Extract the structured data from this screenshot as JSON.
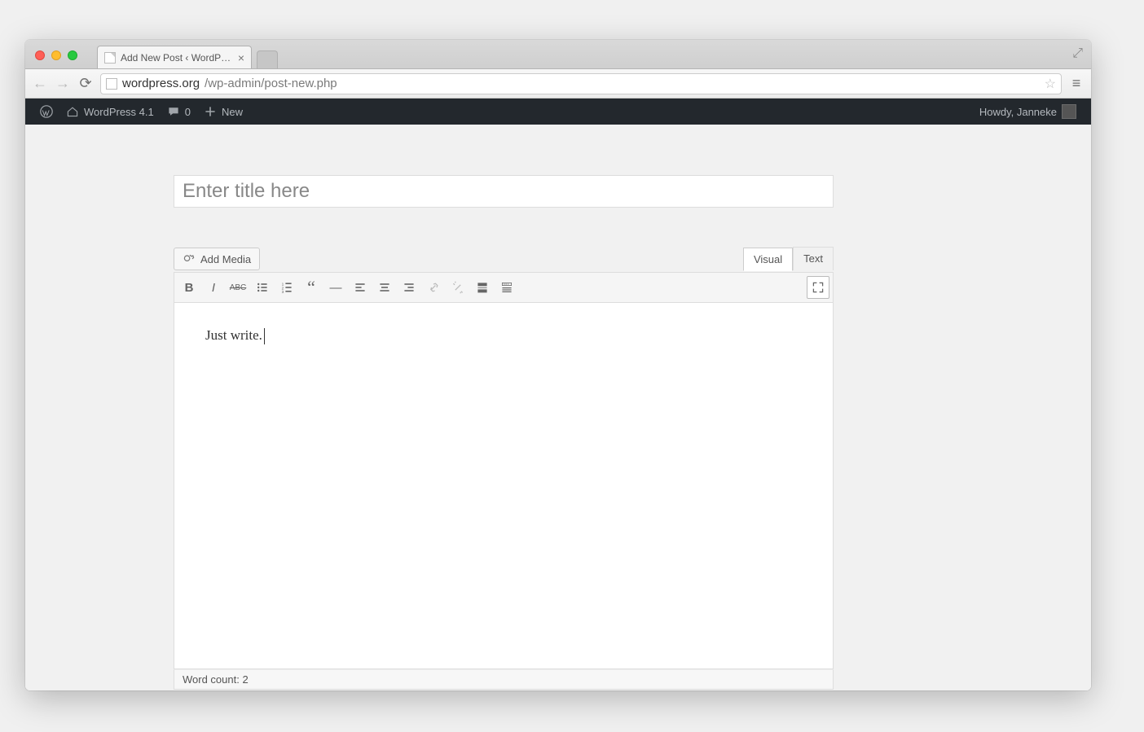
{
  "browser": {
    "tab_title": "Add New Post ‹ WordPress",
    "url_host": "wordpress.org",
    "url_path": "/wp-admin/post-new.php"
  },
  "adminbar": {
    "site_name": "WordPress 4.1",
    "comments_count": "0",
    "new_label": "New",
    "howdy": "Howdy, Janneke"
  },
  "editor": {
    "title_placeholder": "Enter title here",
    "title_value": "",
    "add_media_label": "Add Media",
    "tab_visual": "Visual",
    "tab_text": "Text",
    "content": "Just write.",
    "wordcount_label": "Word count:",
    "wordcount_value": "2"
  }
}
